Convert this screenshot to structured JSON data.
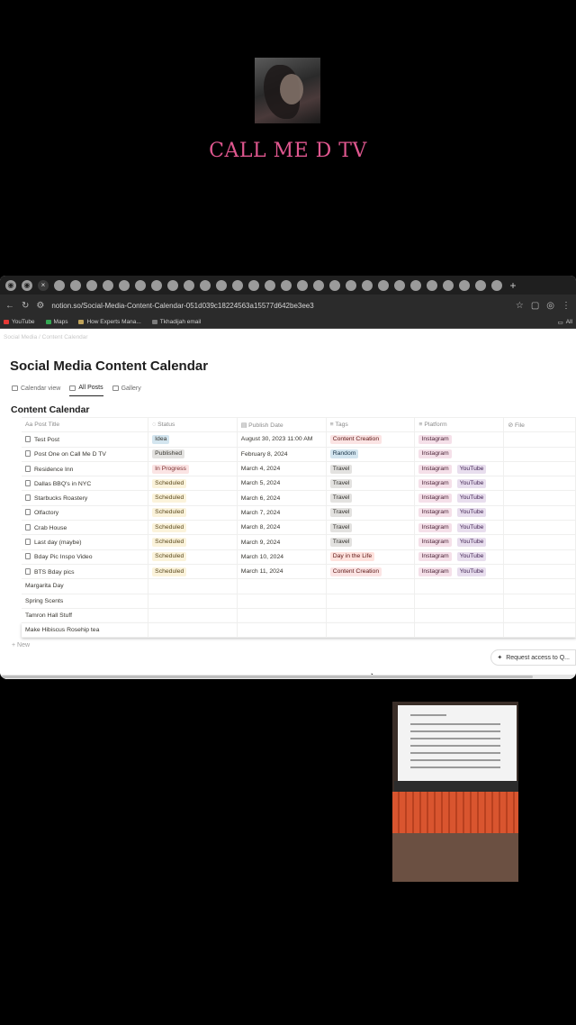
{
  "channel": {
    "name": "CALL ME D TV"
  },
  "browser": {
    "url": "notion.so/Social-Media-Content-Calendar-051d039c18224563a15577d642be3ee3",
    "bookmarks": [
      "YouTube",
      "Maps",
      "How Experts Mana...",
      "Tkhadijah email"
    ],
    "bookmarks_right": "All"
  },
  "page": {
    "breadcrumb": "Social Media / Content Calendar",
    "title": "Social Media Content Calendar",
    "views": [
      "Calendar view",
      "All Posts",
      "Gallery"
    ],
    "selected_view": "All Posts",
    "database_title": "Content Calendar",
    "columns": [
      "Post Title",
      "Status",
      "Publish Date",
      "Tags",
      "Platform",
      "File"
    ],
    "rows": [
      {
        "title": "Test Post",
        "status": "Idea",
        "date": "August 30, 2023 11:00 AM",
        "tag": "Content Creation",
        "platforms": [
          "Instagram"
        ]
      },
      {
        "title": "Post One on Call Me D TV",
        "status": "Published",
        "date": "February 8, 2024",
        "tag": "Random",
        "platforms": [
          "Instagram"
        ]
      },
      {
        "title": "Residence Inn",
        "status": "In Progress",
        "date": "March 4, 2024",
        "tag": "Travel",
        "platforms": [
          "Instagram",
          "YouTube"
        ]
      },
      {
        "title": "Dallas BBQ's in NYC",
        "status": "Scheduled",
        "date": "March 5, 2024",
        "tag": "Travel",
        "platforms": [
          "Instagram",
          "YouTube"
        ]
      },
      {
        "title": "Starbucks Roastery",
        "status": "Scheduled",
        "date": "March 6, 2024",
        "tag": "Travel",
        "platforms": [
          "Instagram",
          "YouTube"
        ]
      },
      {
        "title": "Olfactory",
        "status": "Scheduled",
        "date": "March 7, 2024",
        "tag": "Travel",
        "platforms": [
          "Instagram",
          "YouTube"
        ]
      },
      {
        "title": "Crab House",
        "status": "Scheduled",
        "date": "March 8, 2024",
        "tag": "Travel",
        "platforms": [
          "Instagram",
          "YouTube"
        ]
      },
      {
        "title": "Last day (maybe)",
        "status": "Scheduled",
        "date": "March 9, 2024",
        "tag": "Travel",
        "platforms": [
          "Instagram",
          "YouTube"
        ]
      },
      {
        "title": "Bday Pic Inspo Video",
        "status": "Scheduled",
        "date": "March 10, 2024",
        "tag": "Day in the Life",
        "platforms": [
          "Instagram",
          "YouTube"
        ]
      },
      {
        "title": "BTS Bday pics",
        "status": "Scheduled",
        "date": "March 11, 2024",
        "tag": "Content Creation",
        "platforms": [
          "Instagram",
          "YouTube"
        ]
      },
      {
        "title": "Margarita Day",
        "status": "",
        "date": "",
        "tag": "",
        "platforms": []
      },
      {
        "title": "Spring Scents",
        "status": "",
        "date": "",
        "tag": "",
        "platforms": []
      },
      {
        "title": "Tamron Hall Stuff",
        "status": "",
        "date": "",
        "tag": "",
        "platforms": []
      },
      {
        "title": "Make Hibiscus Rosehip tea",
        "status": "",
        "date": "",
        "tag": "",
        "platforms": []
      }
    ],
    "new_label": "New",
    "request_access": "Request access to Q..."
  }
}
